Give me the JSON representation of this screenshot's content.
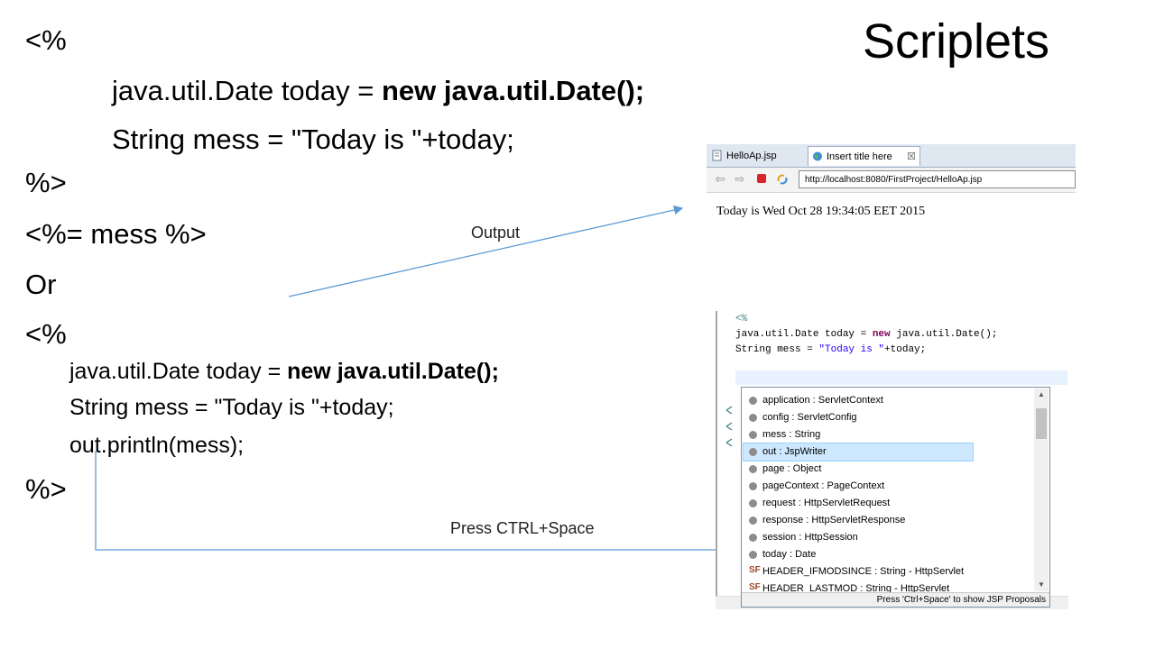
{
  "slide": {
    "title": "Scriplets",
    "code_top": {
      "open": "<%",
      "line1_plain": "java.util.Date today = ",
      "line1_bold": "new java.util.Date();",
      "line2": "String mess = \"Today is \"+today;",
      "close": "%>",
      "expr": "<%= mess %>",
      "or": "Or"
    },
    "code_bottom": {
      "open": "<%",
      "line1_plain": "java.util.Date today = ",
      "line1_bold": "new java.util.Date();",
      "line2": "String mess = \"Today is \"+today;",
      "line3": "out.println(mess);",
      "close": "%>"
    },
    "annotations": {
      "output": "Output",
      "ctrl_space": "Press CTRL+Space"
    }
  },
  "browser": {
    "tabs": [
      {
        "label": "HelloAp.jsp"
      },
      {
        "label": "Insert title here"
      }
    ],
    "tab_close": "☒",
    "url": "http://localhost:8080/FirstProject/HelloAp.jsp",
    "page_text": "Today is Wed Oct 28 19:34:05 EET 2015"
  },
  "editor": {
    "open_tag": "<%",
    "line1_a": "java.util.Date today = ",
    "line1_kw": "new",
    "line1_b": " java.util.Date();",
    "line2_a": "String mess = ",
    "line2_str": "\"Today is \"",
    "line2_b": "+today;",
    "proposals": [
      {
        "label": "application : ServletContext"
      },
      {
        "label": "config : ServletConfig"
      },
      {
        "label": "mess : String"
      },
      {
        "label": "out : JspWriter"
      },
      {
        "label": "page : Object"
      },
      {
        "label": "pageContext : PageContext"
      },
      {
        "label": "request : HttpServletRequest"
      },
      {
        "label": "response : HttpServletResponse"
      },
      {
        "label": "session : HttpSession"
      },
      {
        "label": "today : Date"
      },
      {
        "label": "HEADER_IFMODSINCE : String - HttpServlet"
      },
      {
        "label": "HEADER_LASTMOD : String - HttpServlet"
      }
    ],
    "selected_index": 3,
    "status": "Press 'Ctrl+Space' to show JSP Proposals"
  },
  "colors": {
    "arrow": "#5b9bd5",
    "selection": "#cde8ff",
    "tag": "#3f7f7f",
    "keyword": "#7f0055",
    "string": "#2a00ff"
  },
  "icons": [
    "browser-tab-file-icon",
    "globe-icon",
    "back-arrow-icon",
    "forward-arrow-icon",
    "stop-icon",
    "refresh-icon",
    "field-icon",
    "static-field-icon"
  ]
}
